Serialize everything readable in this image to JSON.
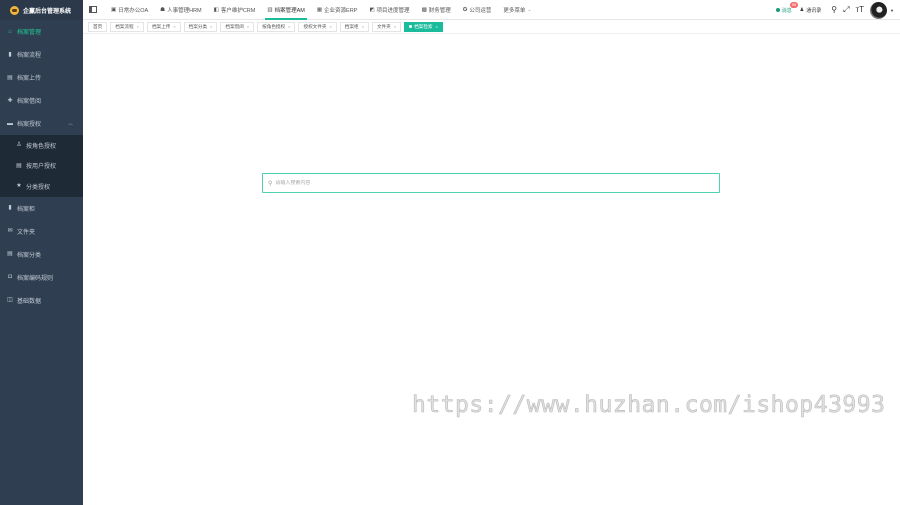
{
  "brand": {
    "title": "企赢后台管理系统"
  },
  "sidebar": {
    "items": [
      {
        "label": "档案管理",
        "icon": "home-icon",
        "glyph": "⌂",
        "active": true
      },
      {
        "label": "档案流程",
        "icon": "bar-chart-icon",
        "glyph": "▮"
      },
      {
        "label": "档案上传",
        "icon": "file-icon",
        "glyph": "▤"
      },
      {
        "label": "档案借阅",
        "icon": "plus-icon",
        "glyph": "✚"
      },
      {
        "label": "档案授权",
        "icon": "folder-icon",
        "glyph": "▬"
      }
    ],
    "submenu": [
      {
        "label": "按角色授权",
        "icon": "user-icon",
        "glyph": "♙"
      },
      {
        "label": "按用户授权",
        "icon": "file-icon",
        "glyph": "▤"
      },
      {
        "label": "分类授权",
        "icon": "star-icon",
        "glyph": "★"
      }
    ],
    "items_after": [
      {
        "label": "档案柜",
        "icon": "bar-chart-icon",
        "glyph": "▮"
      },
      {
        "label": "文件夹",
        "icon": "envelope-icon",
        "glyph": "✉"
      },
      {
        "label": "档案分类",
        "icon": "list-icon",
        "glyph": "▤"
      },
      {
        "label": "档案编码规则",
        "icon": "code-icon",
        "glyph": "◘"
      },
      {
        "label": "基础数据",
        "icon": "database-icon",
        "glyph": "◫"
      }
    ]
  },
  "topnav": {
    "items": [
      {
        "label": "日常办公OA",
        "glyph": "▣"
      },
      {
        "label": "人事管理HRM",
        "glyph": "☗"
      },
      {
        "label": "客户维护CRM",
        "glyph": "◧"
      },
      {
        "label": "档案管理AM",
        "glyph": "▥",
        "active": true
      },
      {
        "label": "企业资源ERP",
        "glyph": "▦"
      },
      {
        "label": "项目进度管理",
        "glyph": "◩"
      },
      {
        "label": "财务管理",
        "glyph": "▩"
      },
      {
        "label": "公司运营",
        "glyph": "✪"
      },
      {
        "label": "更多菜单",
        "glyph": "",
        "chevron": "⌄"
      }
    ],
    "message": {
      "label": "消息",
      "badge": "99"
    },
    "contacts": {
      "label": "通讯录"
    }
  },
  "tabs": [
    {
      "label": "首页",
      "closable": false
    },
    {
      "label": "档案流程",
      "closable": true
    },
    {
      "label": "档案上传",
      "closable": true
    },
    {
      "label": "档案分类",
      "closable": true
    },
    {
      "label": "档案借阅",
      "closable": true
    },
    {
      "label": "按角色授权",
      "closable": true
    },
    {
      "label": "授权文件夹",
      "closable": true
    },
    {
      "label": "档案柜",
      "closable": true
    },
    {
      "label": "文件夹",
      "closable": true
    },
    {
      "label": "档案检索",
      "closable": true,
      "active": true
    }
  ],
  "search": {
    "placeholder": "请输入搜索内容"
  },
  "watermark": "https://www.huzhan.com/ishop43993",
  "colors": {
    "accent": "#1abc9c",
    "sidebar": "#2f3e50",
    "badge": "#f56c6c"
  }
}
